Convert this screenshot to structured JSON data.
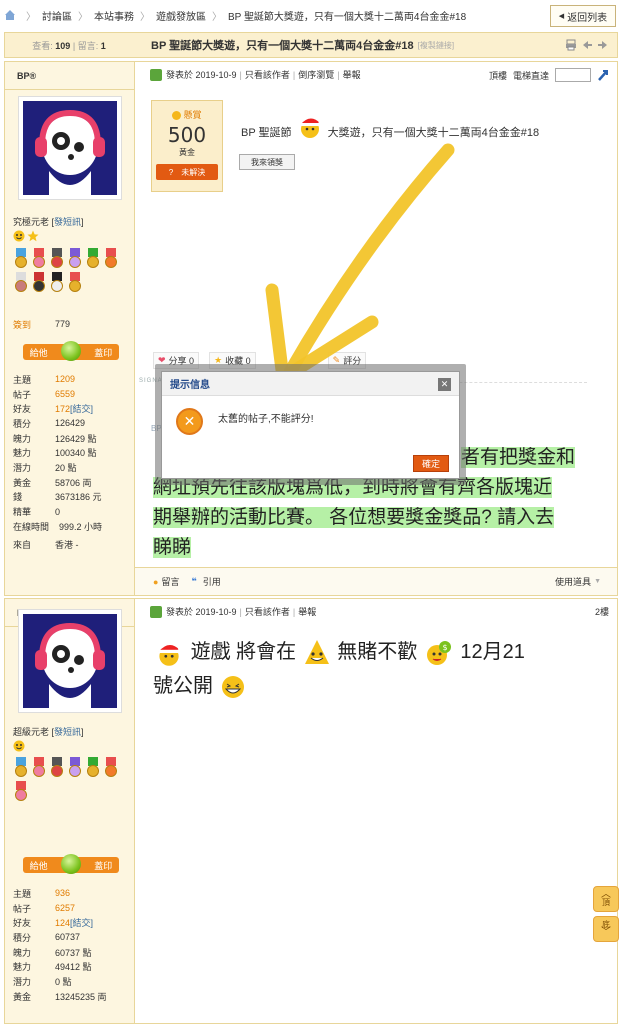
{
  "breadcrumb": {
    "items": [
      "討論區",
      "本站事務",
      "遊戲發放區",
      "BP 聖誕節大獎遊，只有一個大獎十二萬両4台金金#18"
    ],
    "return_label": "返回列表"
  },
  "thread": {
    "views_label": "查看:",
    "views": "109",
    "replies_label": "留言:",
    "replies": "1",
    "title": "BP 聖誕節大獎遊，只有一個大獎十二萬両4台金金#18",
    "copy_link": "[複製鏈接]"
  },
  "post1": {
    "author": "BP®",
    "rank": "究極元老",
    "send_msg": "發短訊",
    "sign_label": "簽到",
    "sign_value": "779",
    "give_label": "給他",
    "stamp_label": "蓋印",
    "stats": [
      {
        "k": "主題",
        "v": "1209"
      },
      {
        "k": "帖子",
        "v": "6559"
      },
      {
        "k": "好友",
        "v": "172",
        "extra": "[結交]"
      },
      {
        "k": "積分",
        "v": "126429"
      },
      {
        "k": "魄力",
        "v": "126429 點"
      },
      {
        "k": "魅力",
        "v": "100340 點"
      },
      {
        "k": "潛力",
        "v": "20 點"
      },
      {
        "k": "黃金",
        "v": "58706 両"
      },
      {
        "k": "錢",
        "v": "3673186 元"
      },
      {
        "k": "精華",
        "v": "0"
      },
      {
        "k": "在線時間",
        "v": "999.2 小時"
      },
      {
        "k": "來自",
        "v": "香港 -"
      }
    ],
    "posted": "發表於 2019-10-9",
    "only_author": "只看該作者",
    "reverse": "倒序瀏覽",
    "report": "舉報",
    "floor_label": "頂樓",
    "jump_label": "電梯直達",
    "reward": {
      "label": "懸賞",
      "amount": "500",
      "unit": "黃金",
      "status": "未解決"
    },
    "text": "BP 聖誕節",
    "text_tail": "大獎遊，只有一個大獎十二萬両4台金金#18",
    "claim_btn": "我來領獎",
    "share": "分享 0",
    "fav": "收藏 0",
    "rate": "評分",
    "signature": "SIGNA",
    "faint_text": "BP",
    "body_line1": "者有把獎金和",
    "body_line2": "網址預先往該版塊爲低，到時將會有齊各版塊近",
    "body_line3": "期舉辦的活動比賽。 各位想要獎金獎品? 請入去",
    "body_line4": "睇睇",
    "reply": "留言",
    "quote": "引用",
    "tools": "使用道具"
  },
  "dialog": {
    "title": "提示信息",
    "message": "太舊的帖子,不能評分!",
    "ok": "確定"
  },
  "post2": {
    "author": "BP©",
    "rank": "超級元老",
    "send_msg": "發短訊",
    "give_label": "給他",
    "stamp_label": "蓋印",
    "posted": "發表於 2019-10-9",
    "only_author": "只看該作者",
    "report": "舉報",
    "floor": "2樓",
    "stats": [
      {
        "k": "主題",
        "v": "936"
      },
      {
        "k": "帖子",
        "v": "6257"
      },
      {
        "k": "好友",
        "v": "124",
        "extra": "[結交]"
      },
      {
        "k": "積分",
        "v": "60737"
      },
      {
        "k": "魄力",
        "v": "60737 點"
      },
      {
        "k": "魅力",
        "v": "49412 點"
      },
      {
        "k": "潛力",
        "v": "0 點"
      },
      {
        "k": "黃金",
        "v": "13245235 両"
      }
    ],
    "text_a": "遊戲 將會在",
    "text_b": "無賭不歡",
    "text_c": "12月21",
    "text_d": "號公開"
  },
  "scroll": {
    "top": "頂",
    "bottom": "底"
  },
  "colors": {
    "accent": "#e25a12",
    "highlight": "#b6f0a6",
    "arrow": "#f2c42a",
    "side_bg": "#fdf6e0"
  }
}
